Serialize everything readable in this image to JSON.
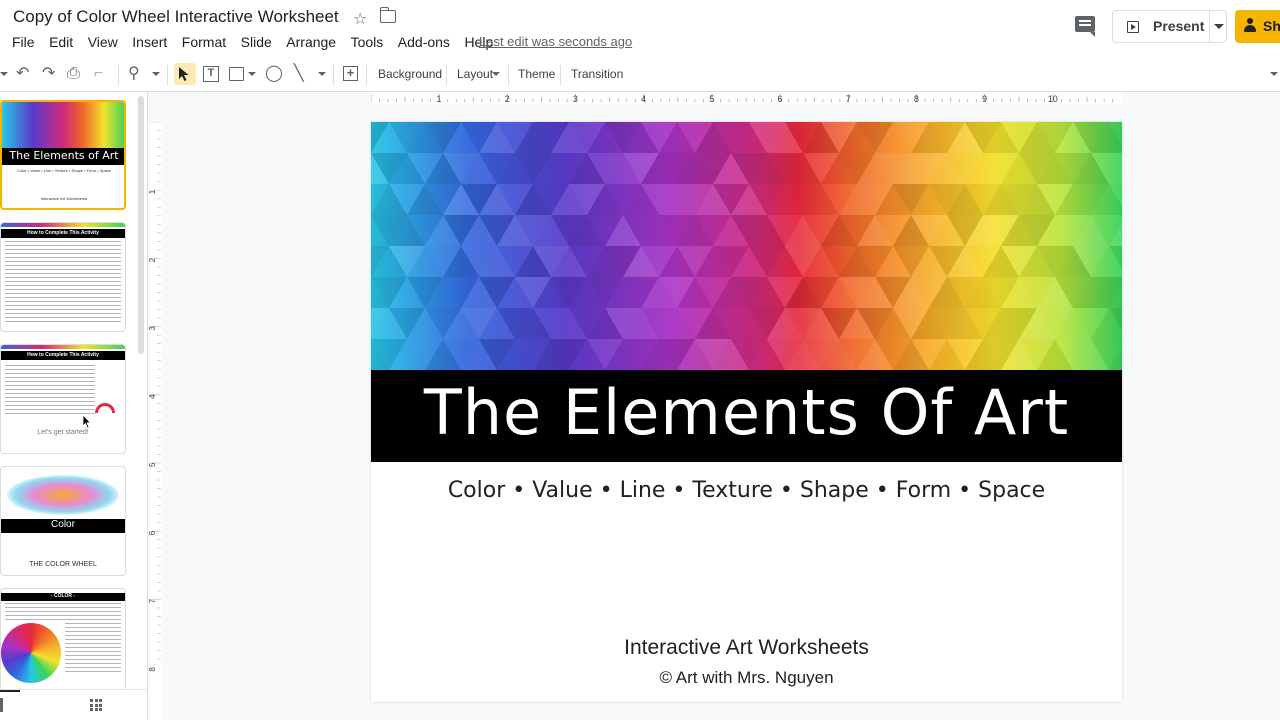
{
  "header": {
    "doc_title": "Copy of Color Wheel Interactive Worksheet",
    "menu": [
      "File",
      "Edit",
      "View",
      "Insert",
      "Format",
      "Slide",
      "Arrange",
      "Tools",
      "Add-ons",
      "Help"
    ],
    "last_edit": "Last edit was seconds ago",
    "present_label": "Present",
    "share_label": "Sh"
  },
  "toolbar": {
    "background_label": "Background",
    "layout_label": "Layout",
    "theme_label": "Theme",
    "transition_label": "Transition"
  },
  "ruler": {
    "horizontal": [
      "1",
      "2",
      "3",
      "4",
      "5",
      "6",
      "7",
      "8",
      "9",
      "10"
    ],
    "vertical": [
      "1",
      "2",
      "3",
      "4",
      "5",
      "6",
      "7",
      "8"
    ]
  },
  "filmstrip": {
    "slides": [
      {
        "title": "The Elements of Art",
        "subtitle": "Color • Value • Line • Texture • Shape • Form • Space",
        "footer": "Interactive Art Worksheets"
      },
      {
        "heading": "How to Complete This Activity"
      },
      {
        "heading": "How to Complete This Activity",
        "note": "Let's get started!"
      },
      {
        "title": "Color",
        "caption": "THE COLOR WHEEL"
      },
      {
        "heading": "- COLOR -"
      }
    ]
  },
  "slide": {
    "title": "The Elements Of Art",
    "subtitle": "Color • Value • Line • Texture • Shape • Form • Space",
    "footer_line1": "Interactive Art Worksheets",
    "footer_line2": "© Art with Mrs. Nguyen"
  },
  "colors": {
    "accent_yellow": "#f4b400",
    "gradient": [
      "#27c7e6",
      "#3466dd",
      "#5a3acb",
      "#a832c4",
      "#d22a7a",
      "#e7283c",
      "#f0672a",
      "#f7ab2b",
      "#f5e02c",
      "#b9e43d",
      "#38d35d"
    ]
  }
}
